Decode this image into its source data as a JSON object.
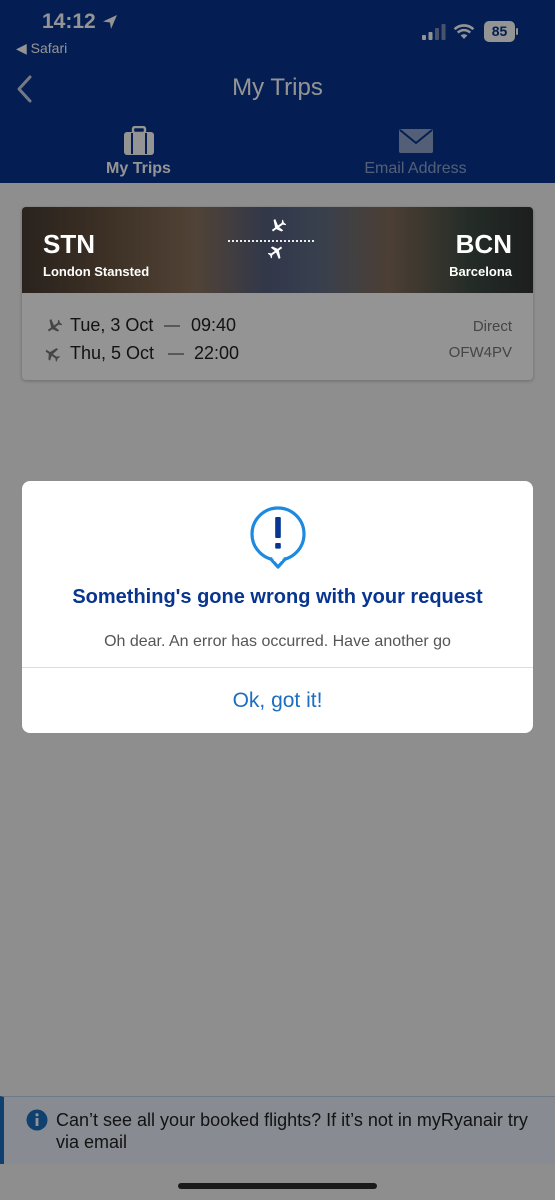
{
  "status_bar": {
    "time": "14:12",
    "back_app_label": "◀ Safari",
    "battery_level": "85"
  },
  "header": {
    "title": "My Trips",
    "tabs": [
      {
        "label": "My Trips",
        "icon": "suitcase-icon",
        "active": true
      },
      {
        "label": "Email Address",
        "icon": "envelope-icon",
        "active": false
      }
    ]
  },
  "trip_card": {
    "origin_code": "STN",
    "origin_city": "London Stansted",
    "destination_code": "BCN",
    "destination_city": "Barcelona",
    "outbound": {
      "date": "Tue, 3 Oct",
      "time": "09:40"
    },
    "return": {
      "date": "Thu, 5 Oct",
      "time": "22:00"
    },
    "flight_type": "Direct",
    "booking_reference": "OFW4PV"
  },
  "dialog": {
    "icon": "alert-bubble-icon",
    "title": "Something's gone wrong with your request",
    "message": "Oh dear. An error has occurred. Have another go",
    "button_label": "Ok, got it!"
  },
  "info_banner": {
    "text": "Can’t see all your booked flights? If it’s not in myRyanair try via email"
  },
  "colors": {
    "brand_navy": "#073590",
    "link_blue": "#1d6ec2"
  }
}
